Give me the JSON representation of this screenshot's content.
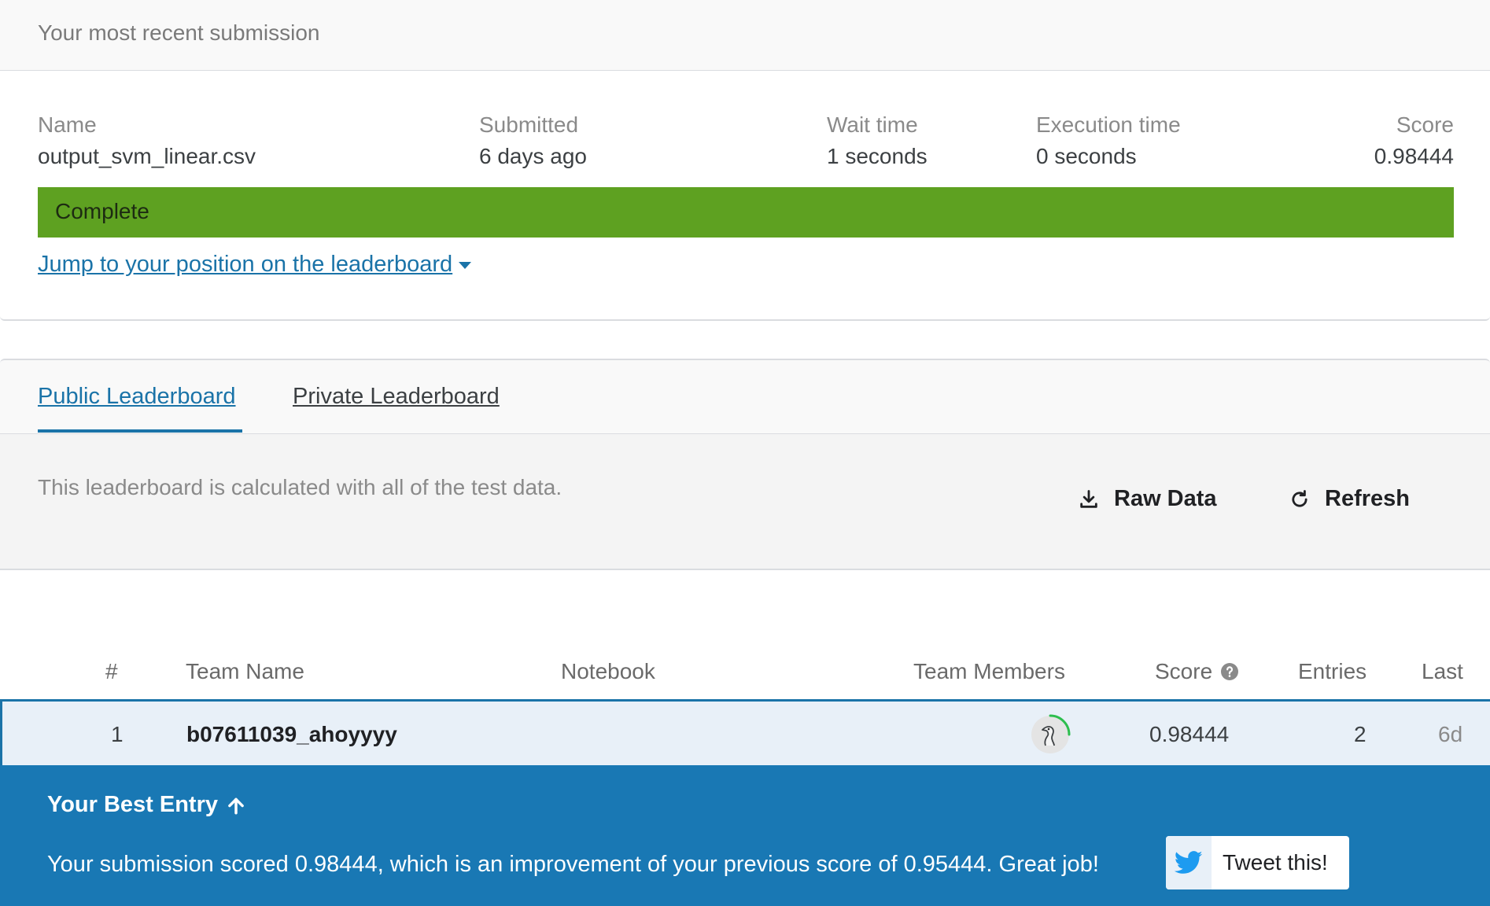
{
  "submission": {
    "header": "Your most recent submission",
    "name_label": "Name",
    "name_value": "output_svm_linear.csv",
    "submitted_label": "Submitted",
    "submitted_value": "6 days ago",
    "wait_label": "Wait time",
    "wait_value": "1 seconds",
    "exec_label": "Execution time",
    "exec_value": "0 seconds",
    "score_label": "Score",
    "score_value": "0.98444",
    "status": "Complete",
    "status_color": "#5ea121",
    "jump_link": "Jump to your position on the leaderboard"
  },
  "leaderboard": {
    "tabs": [
      {
        "label": "Public Leaderboard",
        "active": true
      },
      {
        "label": "Private Leaderboard",
        "active": false
      }
    ],
    "description": "This leaderboard is calculated with all of the test data.",
    "raw_data_label": "Raw Data",
    "refresh_label": "Refresh",
    "columns": {
      "rank": "#",
      "team": "Team Name",
      "notebook": "Notebook",
      "members": "Team Members",
      "score": "Score",
      "entries": "Entries",
      "last": "Last"
    },
    "rows": [
      {
        "rank": "1",
        "team": "b07611039_ahoyyyy",
        "notebook": "",
        "score": "0.98444",
        "entries": "2",
        "last": "6d",
        "avatar_icon": "goose-avatar-icon"
      }
    ],
    "accent_color": "#1a73a8"
  },
  "banner": {
    "heading": "Your Best Entry",
    "message": "Your submission scored 0.98444, which is an improvement of your previous score of 0.95444. Great job!",
    "tweet_label": "Tweet this!",
    "background_color": "#1978b4"
  }
}
